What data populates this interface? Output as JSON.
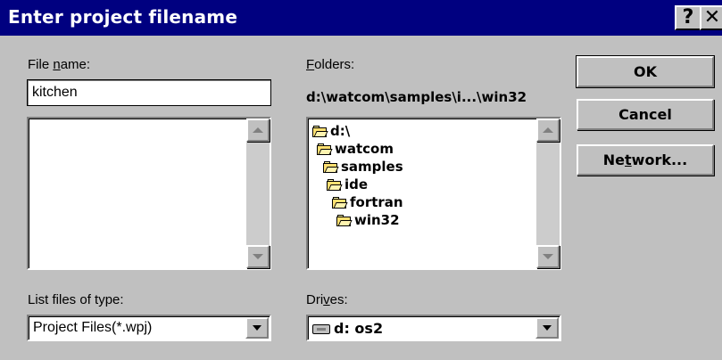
{
  "window": {
    "title": "Enter project filename",
    "help_glyph": "?",
    "close_glyph": "✕"
  },
  "file_name": {
    "label_prefix": "File ",
    "label_underlined": "n",
    "label_suffix": "ame:",
    "value": "kitchen",
    "files": []
  },
  "folders": {
    "label_underlined": "F",
    "label_suffix": "olders:",
    "current_path": "d:\\watcom\\samples\\i...\\win32",
    "tree": [
      {
        "label": "d:\\"
      },
      {
        "label": "watcom"
      },
      {
        "label": "samples"
      },
      {
        "label": "ide"
      },
      {
        "label": "fortran"
      },
      {
        "label": "win32"
      }
    ]
  },
  "file_type": {
    "label": "List files of type:",
    "selected": "Project Files(*.wpj)"
  },
  "drives": {
    "label_prefix": "Dri",
    "label_underlined": "v",
    "label_suffix": "es:",
    "selected": "d: os2"
  },
  "buttons": {
    "ok": "OK",
    "cancel": "Cancel",
    "network_prefix": "Ne",
    "network_underlined": "t",
    "network_suffix": "work..."
  },
  "icons": [
    "folder-icon",
    "drive-icon",
    "help-icon",
    "close-icon",
    "scroll-up-icon",
    "scroll-down-icon",
    "dropdown-arrow-icon"
  ],
  "colors": {
    "titlebar": "#000080",
    "face": "#c0c0c0",
    "field": "#ffffff"
  }
}
